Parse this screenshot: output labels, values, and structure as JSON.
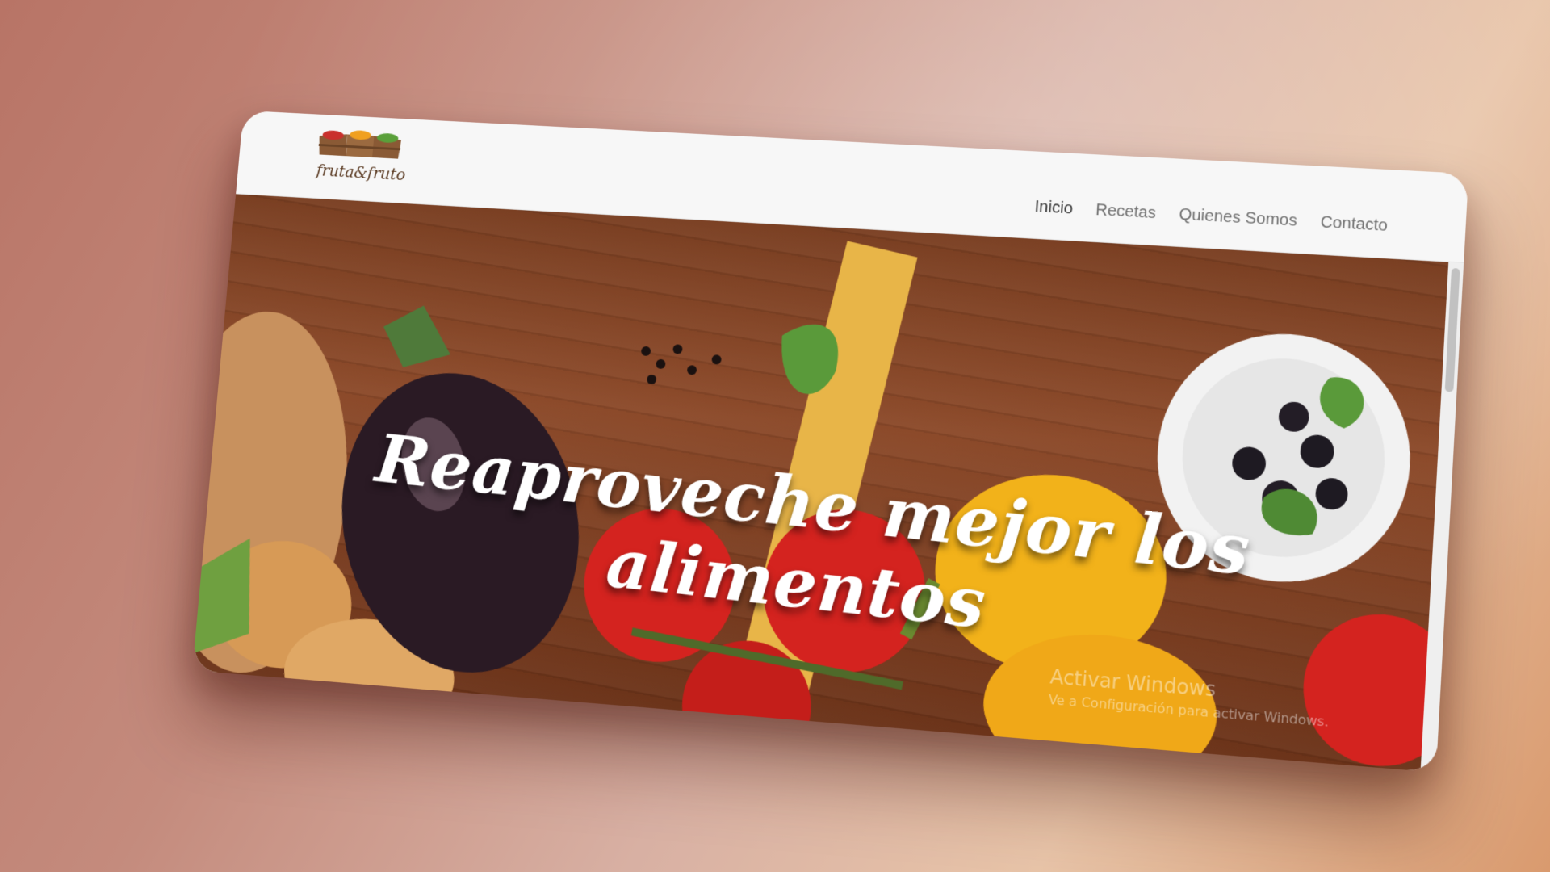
{
  "brand": {
    "logo_text": "fruta&fruto"
  },
  "nav": {
    "items": [
      {
        "label": "Inicio",
        "active": true
      },
      {
        "label": "Recetas",
        "active": false
      },
      {
        "label": "Quienes Somos",
        "active": false
      },
      {
        "label": "Contacto",
        "active": false
      }
    ]
  },
  "hero": {
    "title": "Reaproveche mejor los alimentos"
  },
  "watermark": {
    "title": "Activar Windows",
    "subtitle": "Ve a Configuración para activar Windows."
  },
  "colors": {
    "wood": "#8c4a2a",
    "header_bg": "#f7f7f7",
    "nav_text": "#707070",
    "nav_active": "#333333"
  }
}
